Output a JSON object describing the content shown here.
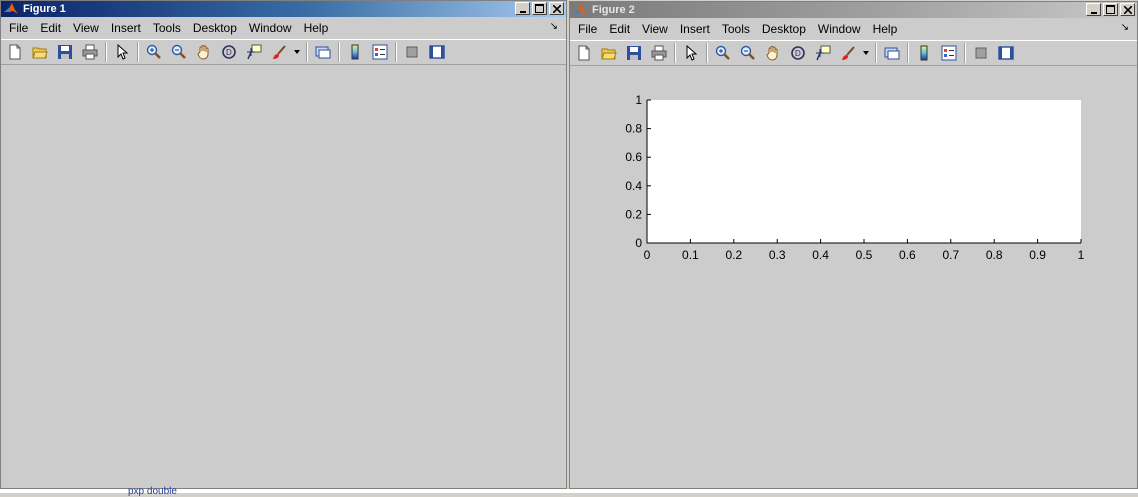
{
  "window1": {
    "title": "Figure 1",
    "menus": [
      "File",
      "Edit",
      "View",
      "Insert",
      "Tools",
      "Desktop",
      "Window",
      "Help"
    ],
    "toolbar_icons": [
      "new-figure-icon",
      "open-file-icon",
      "save-icon",
      "print-icon",
      "select-arrow-icon",
      "zoom-in-icon",
      "zoom-out-icon",
      "pan-hand-icon",
      "rotate-3d-icon",
      "data-cursor-icon",
      "brush-icon",
      "brush-dropdown-icon",
      "link-plot-icon",
      "colorbar-icon",
      "legend-icon",
      "hide-plot-tools-icon",
      "show-plot-tools-icon"
    ]
  },
  "window2": {
    "title": "Figure 2",
    "menus": [
      "File",
      "Edit",
      "View",
      "Insert",
      "Tools",
      "Desktop",
      "Window",
      "Help"
    ]
  },
  "chart_data": {
    "type": "line",
    "series": [],
    "xlim": [
      0,
      1
    ],
    "ylim": [
      0,
      1
    ],
    "xticks": [
      "0",
      "0.1",
      "0.2",
      "0.3",
      "0.4",
      "0.5",
      "0.6",
      "0.7",
      "0.8",
      "0.9",
      "1"
    ],
    "yticks": [
      "0",
      "0.2",
      "0.4",
      "0.6",
      "0.8",
      "1"
    ],
    "grid": false
  },
  "background_partial_text": "pxp double"
}
